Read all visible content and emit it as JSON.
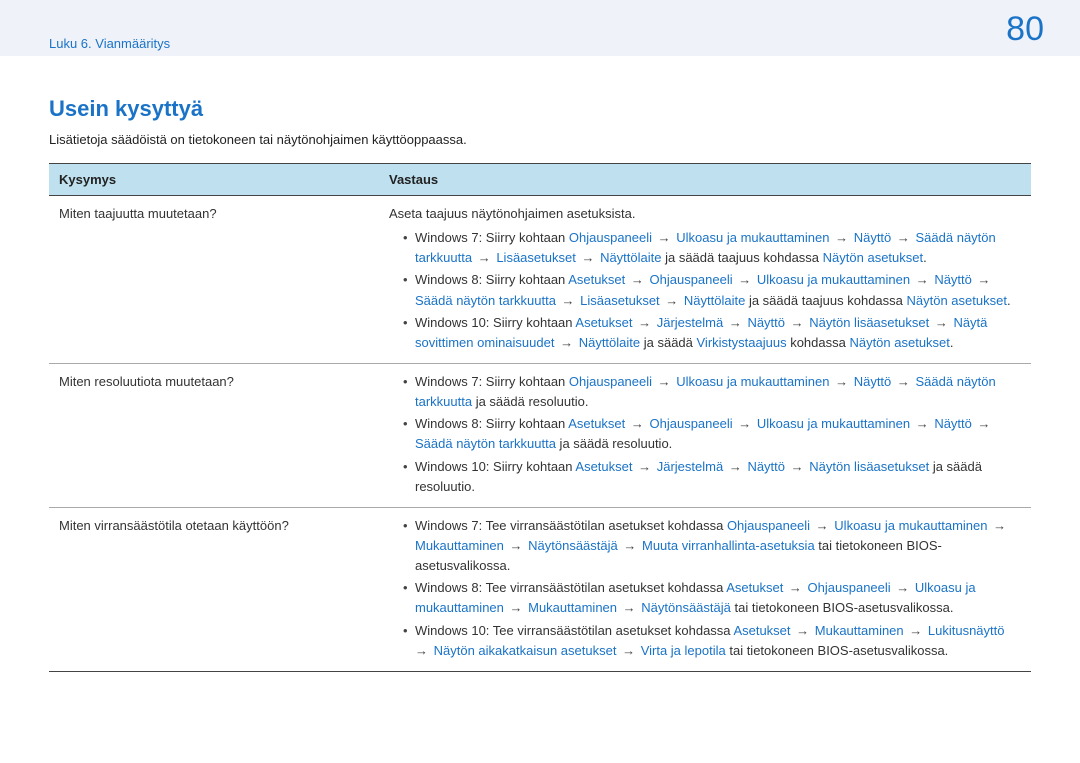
{
  "header": {
    "breadcrumb": "Luku 6. Vianmääritys",
    "page_number": "80"
  },
  "title": "Usein kysyttyä",
  "intro": "Lisätietoja säädöistä on tietokoneen tai näytönohjaimen käyttöoppaassa.",
  "table": {
    "head_q": "Kysymys",
    "head_a": "Vastaus",
    "rows": [
      {
        "question": "Miten taajuutta muutetaan?",
        "lead": "Aseta taajuus näytönohjaimen asetuksista.",
        "bullets": [
          [
            {
              "t": "plain",
              "v": "Windows 7: Siirry kohtaan "
            },
            {
              "t": "link",
              "v": "Ohjauspaneeli"
            },
            {
              "t": "arrow"
            },
            {
              "t": "link",
              "v": "Ulkoasu ja mukauttaminen"
            },
            {
              "t": "arrow"
            },
            {
              "t": "link",
              "v": "Näyttö"
            },
            {
              "t": "arrow"
            },
            {
              "t": "link",
              "v": "Säädä näytön tarkkuutta"
            },
            {
              "t": "arrow"
            },
            {
              "t": "link",
              "v": "Lisäasetukset"
            },
            {
              "t": "arrow"
            },
            {
              "t": "link",
              "v": "Näyttölaite"
            },
            {
              "t": "plain",
              "v": " ja säädä taajuus kohdassa "
            },
            {
              "t": "link",
              "v": "Näytön asetukset"
            },
            {
              "t": "plain",
              "v": "."
            }
          ],
          [
            {
              "t": "plain",
              "v": "Windows 8: Siirry kohtaan "
            },
            {
              "t": "link",
              "v": "Asetukset"
            },
            {
              "t": "arrow"
            },
            {
              "t": "link",
              "v": "Ohjauspaneeli"
            },
            {
              "t": "arrow"
            },
            {
              "t": "link",
              "v": "Ulkoasu ja mukauttaminen"
            },
            {
              "t": "arrow"
            },
            {
              "t": "link",
              "v": "Näyttö"
            },
            {
              "t": "arrow"
            },
            {
              "t": "link",
              "v": "Säädä näytön tarkkuutta"
            },
            {
              "t": "arrow"
            },
            {
              "t": "link",
              "v": "Lisäasetukset"
            },
            {
              "t": "arrow"
            },
            {
              "t": "link",
              "v": "Näyttölaite"
            },
            {
              "t": "plain",
              "v": " ja säädä taajuus kohdassa "
            },
            {
              "t": "link",
              "v": "Näytön asetukset"
            },
            {
              "t": "plain",
              "v": "."
            }
          ],
          [
            {
              "t": "plain",
              "v": "Windows 10: Siirry kohtaan "
            },
            {
              "t": "link",
              "v": "Asetukset"
            },
            {
              "t": "arrow"
            },
            {
              "t": "link",
              "v": "Järjestelmä"
            },
            {
              "t": "arrow"
            },
            {
              "t": "link",
              "v": "Näyttö"
            },
            {
              "t": "arrow"
            },
            {
              "t": "link",
              "v": "Näytön lisäasetukset"
            },
            {
              "t": "arrow"
            },
            {
              "t": "link",
              "v": "Näytä sovittimen ominaisuudet"
            },
            {
              "t": "arrow"
            },
            {
              "t": "link",
              "v": "Näyttölaite"
            },
            {
              "t": "plain",
              "v": " ja säädä "
            },
            {
              "t": "link",
              "v": "Virkistystaajuus"
            },
            {
              "t": "plain",
              "v": " kohdassa "
            },
            {
              "t": "link",
              "v": "Näytön asetukset"
            },
            {
              "t": "plain",
              "v": "."
            }
          ]
        ]
      },
      {
        "question": "Miten resoluutiota muutetaan?",
        "bullets": [
          [
            {
              "t": "plain",
              "v": "Windows 7: Siirry kohtaan "
            },
            {
              "t": "link",
              "v": "Ohjauspaneeli"
            },
            {
              "t": "arrow"
            },
            {
              "t": "link",
              "v": "Ulkoasu ja mukauttaminen"
            },
            {
              "t": "arrow"
            },
            {
              "t": "link",
              "v": "Näyttö"
            },
            {
              "t": "arrow"
            },
            {
              "t": "link",
              "v": "Säädä näytön tarkkuutta"
            },
            {
              "t": "plain",
              "v": " ja säädä resoluutio."
            }
          ],
          [
            {
              "t": "plain",
              "v": "Windows 8: Siirry kohtaan "
            },
            {
              "t": "link",
              "v": "Asetukset"
            },
            {
              "t": "arrow"
            },
            {
              "t": "link",
              "v": "Ohjauspaneeli"
            },
            {
              "t": "arrow"
            },
            {
              "t": "link",
              "v": "Ulkoasu ja mukauttaminen"
            },
            {
              "t": "arrow"
            },
            {
              "t": "link",
              "v": "Näyttö"
            },
            {
              "t": "arrow"
            },
            {
              "t": "link",
              "v": "Säädä näytön tarkkuutta"
            },
            {
              "t": "plain",
              "v": " ja säädä resoluutio."
            }
          ],
          [
            {
              "t": "plain",
              "v": "Windows 10: Siirry kohtaan "
            },
            {
              "t": "link",
              "v": "Asetukset"
            },
            {
              "t": "arrow"
            },
            {
              "t": "link",
              "v": "Järjestelmä"
            },
            {
              "t": "arrow"
            },
            {
              "t": "link",
              "v": "Näyttö"
            },
            {
              "t": "arrow"
            },
            {
              "t": "link",
              "v": "Näytön lisäasetukset"
            },
            {
              "t": "plain",
              "v": " ja säädä resoluutio."
            }
          ]
        ]
      },
      {
        "question": "Miten virransäästötila otetaan käyttöön?",
        "bullets": [
          [
            {
              "t": "plain",
              "v": "Windows 7: Tee virransäästötilan asetukset kohdassa "
            },
            {
              "t": "link",
              "v": "Ohjauspaneeli"
            },
            {
              "t": "arrow"
            },
            {
              "t": "link",
              "v": "Ulkoasu ja mukauttaminen"
            },
            {
              "t": "arrow"
            },
            {
              "t": "link",
              "v": "Mukauttaminen"
            },
            {
              "t": "arrow"
            },
            {
              "t": "link",
              "v": "Näytönsäästäjä"
            },
            {
              "t": "arrow"
            },
            {
              "t": "link",
              "v": "Muuta virranhallinta-asetuksia"
            },
            {
              "t": "plain",
              "v": " tai tietokoneen BIOS-asetusvalikossa."
            }
          ],
          [
            {
              "t": "plain",
              "v": "Windows 8: Tee virransäästötilan asetukset kohdassa "
            },
            {
              "t": "link",
              "v": "Asetukset"
            },
            {
              "t": "arrow"
            },
            {
              "t": "link",
              "v": "Ohjauspaneeli"
            },
            {
              "t": "arrow"
            },
            {
              "t": "link",
              "v": "Ulkoasu ja mukauttaminen"
            },
            {
              "t": "arrow"
            },
            {
              "t": "link",
              "v": "Mukauttaminen"
            },
            {
              "t": "arrow"
            },
            {
              "t": "link",
              "v": "Näytönsäästäjä"
            },
            {
              "t": "plain",
              "v": " tai tietokoneen BIOS-asetusvalikossa."
            }
          ],
          [
            {
              "t": "plain",
              "v": "Windows 10: Tee virransäästötilan asetukset kohdassa "
            },
            {
              "t": "link",
              "v": "Asetukset"
            },
            {
              "t": "arrow"
            },
            {
              "t": "link",
              "v": "Mukauttaminen"
            },
            {
              "t": "arrow"
            },
            {
              "t": "link",
              "v": "Lukitusnäyttö"
            },
            {
              "t": "arrow"
            },
            {
              "t": "link",
              "v": "Näytön aikakatkaisun asetukset"
            },
            {
              "t": "arrow"
            },
            {
              "t": "link",
              "v": "Virta ja lepotila"
            },
            {
              "t": "plain",
              "v": " tai tietokoneen BIOS-asetusvalikossa."
            }
          ]
        ]
      }
    ]
  }
}
